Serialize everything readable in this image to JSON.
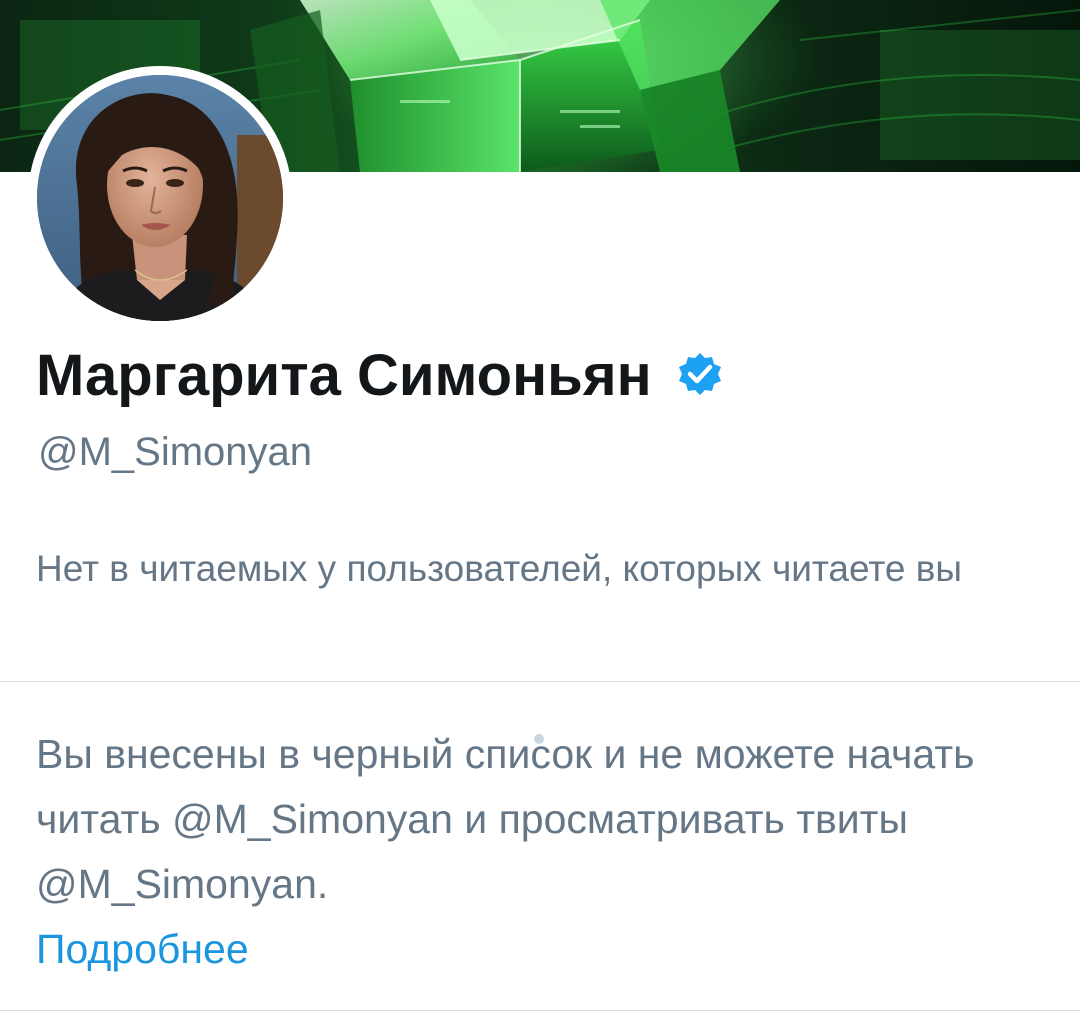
{
  "profile": {
    "display_name": "Маргарита Симоньян",
    "handle": "@M_Simonyan",
    "verified": true,
    "verified_icon": "verified-badge-icon",
    "follow_context": "Нет в читаемых у пользователей, которых читаете вы"
  },
  "blocked": {
    "notice": "Вы внесены в черный список и не можете начать читать @M_Simonyan и просматривать твиты @M_Simonyan.",
    "learn_more": "Подробнее"
  },
  "colors": {
    "text_primary": "#14171a",
    "text_secondary": "#657786",
    "link": "#1b95e0",
    "verified": "#1da1f2",
    "banner_accent": "#3fd64a"
  }
}
